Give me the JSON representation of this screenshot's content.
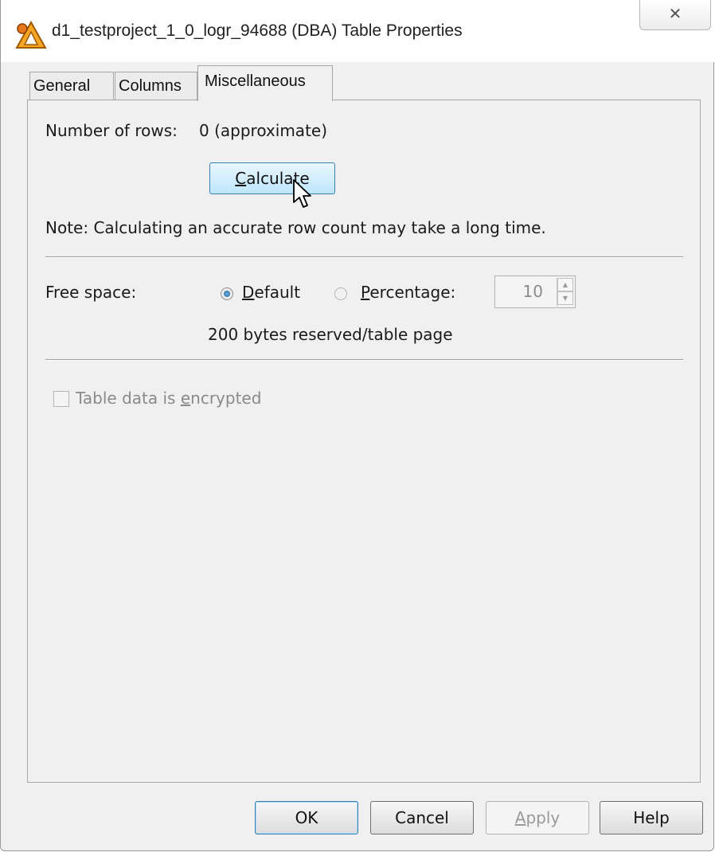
{
  "window": {
    "title": "d1_testproject_1_0_logr_94688 (DBA) Table Properties",
    "close_glyph": "✕"
  },
  "tabs": [
    {
      "label": "General",
      "active": false
    },
    {
      "label": "Columns",
      "active": false
    },
    {
      "label": "Miscellaneous",
      "active": true
    }
  ],
  "rows": {
    "label": "Number of rows:",
    "value": "0 (approximate)",
    "calculate_mnemonic": "C",
    "calculate_rest": "alculate",
    "note": "Note: Calculating an accurate row count may take a long time."
  },
  "free_space": {
    "label": "Free space:",
    "default_mnemonic": "D",
    "default_rest": "efault",
    "percentage_mnemonic": "P",
    "percentage_rest": "ercentage:",
    "percentage_value": "10",
    "reserved_text": "200 bytes reserved/table page",
    "selected": "default"
  },
  "encryption": {
    "label_before": "Table data is ",
    "label_mnemonic": "e",
    "label_after": "ncrypted",
    "checked": false
  },
  "footer": {
    "ok_label": "OK",
    "cancel_label": "Cancel",
    "apply_mnemonic": "A",
    "apply_rest": "pply",
    "help_label": "Help"
  },
  "colors": {
    "accent": "#3c7fb1",
    "window_bg": "#f0f0f0"
  }
}
